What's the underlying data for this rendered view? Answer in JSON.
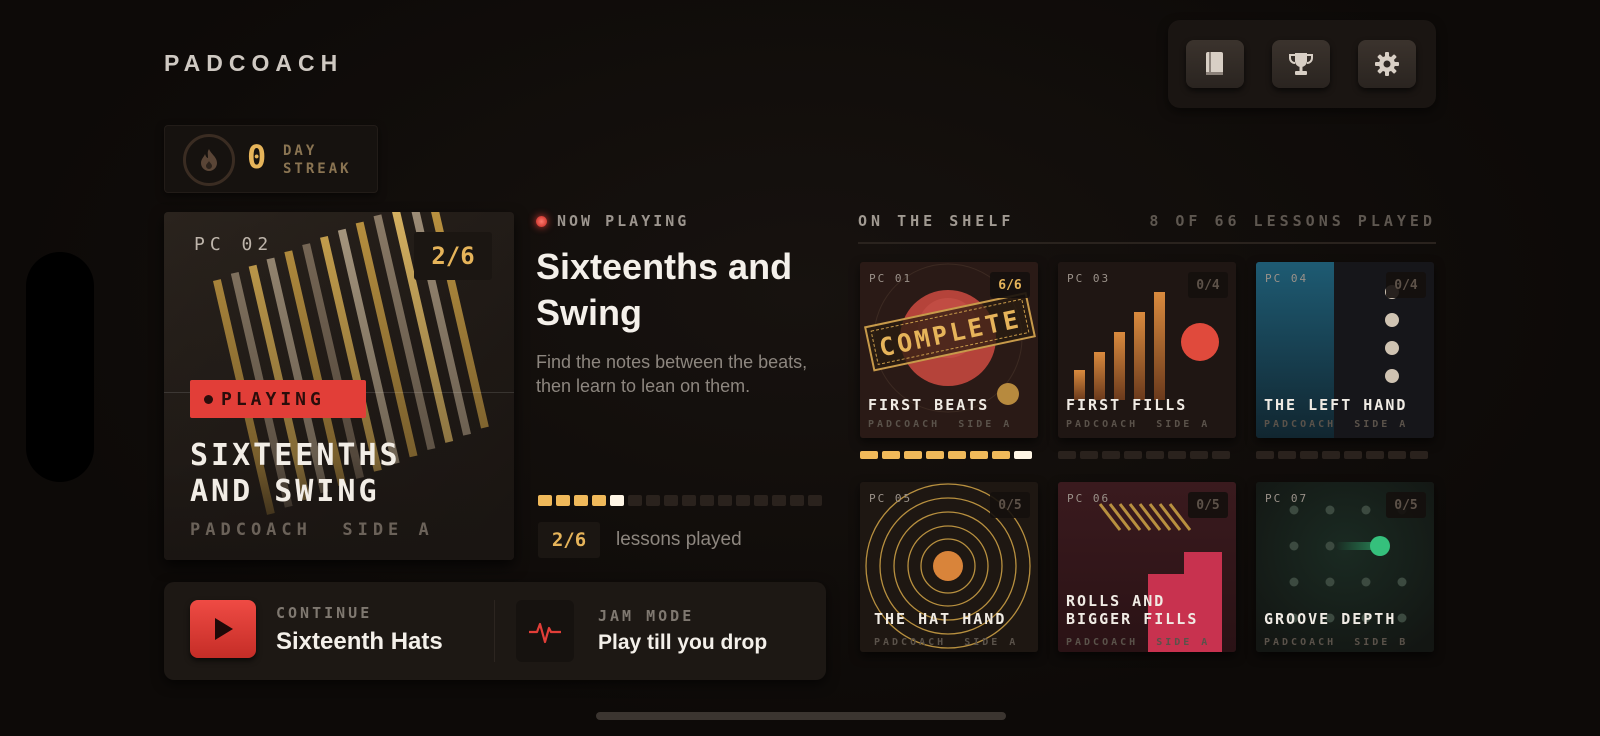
{
  "app": {
    "brand": "PADCOACH"
  },
  "toolbar": {
    "icons": [
      "book-icon",
      "trophy-icon",
      "gear-icon"
    ]
  },
  "streak": {
    "count": "0",
    "label_line1": "DAY",
    "label_line2": "STREAK",
    "icon": "flame-icon"
  },
  "current_card": {
    "id": "PC 02",
    "count": "2/6",
    "status": "PLAYING",
    "title_line1": "SIXTEENTHS",
    "title_line2": "AND SWING",
    "subtitle": "PADCOACH  SIDE A"
  },
  "now_playing": {
    "header": "NOW PLAYING",
    "title": "Sixteenths and Swing",
    "description": "Find the notes between the beats, then learn to lean on them.",
    "progress": {
      "played": 4,
      "current": 1,
      "total": 16
    },
    "lessons_badge": "2/6",
    "lessons_label": "lessons played"
  },
  "actions": {
    "continue_label": "CONTINUE",
    "continue_title": "Sixteenth Hats",
    "jam_label": "JAM MODE",
    "jam_title": "Play till you drop"
  },
  "shelf": {
    "title": "ON THE SHELF",
    "summary": "8 OF 66 LESSONS PLAYED",
    "lessons": [
      {
        "id": "PC 01",
        "count": "6/6",
        "title": "FIRST BEATS",
        "subtitle": "PADCOACH  SIDE A",
        "stamp": "COMPLETE",
        "progress": {
          "played": 7,
          "current": 1,
          "total": 8
        }
      },
      {
        "id": "PC 03",
        "count": "0/4",
        "title": "FIRST FILLS",
        "subtitle": "PADCOACH  SIDE A",
        "progress": {
          "played": 0,
          "current": 0,
          "total": 8
        }
      },
      {
        "id": "PC 04",
        "count": "0/4",
        "title": "THE LEFT HAND",
        "subtitle": "PADCOACH  SIDE A",
        "progress": {
          "played": 0,
          "current": 0,
          "total": 8
        }
      },
      {
        "id": "PC 05",
        "count": "0/5",
        "title": "THE HAT HAND",
        "subtitle": "PADCOACH  SIDE A"
      },
      {
        "id": "PC 06",
        "count": "0/5",
        "title_line1": "ROLLS AND",
        "title_line2": "BIGGER FILLS",
        "subtitle": "PADCOACH  SIDE A"
      },
      {
        "id": "PC 07",
        "count": "0/5",
        "title": "GROOVE DEPTH",
        "subtitle": "PADCOACH  SIDE B"
      }
    ]
  }
}
